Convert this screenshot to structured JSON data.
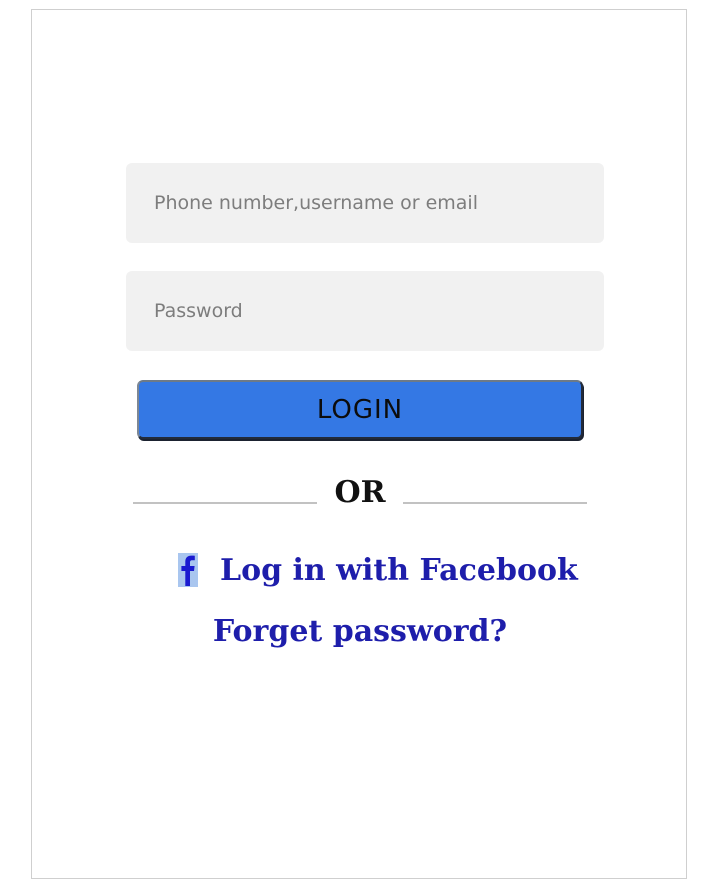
{
  "login_form": {
    "username_placeholder": "Phone number,username or email",
    "password_placeholder": "Password",
    "login_label": "LOGIN",
    "divider_label": "OR",
    "facebook_label": "Log in with Facebook",
    "forgot_label": "Forget password?"
  },
  "icons": {
    "facebook": "facebook-icon"
  },
  "colors": {
    "login_button": "#3478e4",
    "link_text": "#1e1eab",
    "field_background": "#f1f1f1"
  }
}
